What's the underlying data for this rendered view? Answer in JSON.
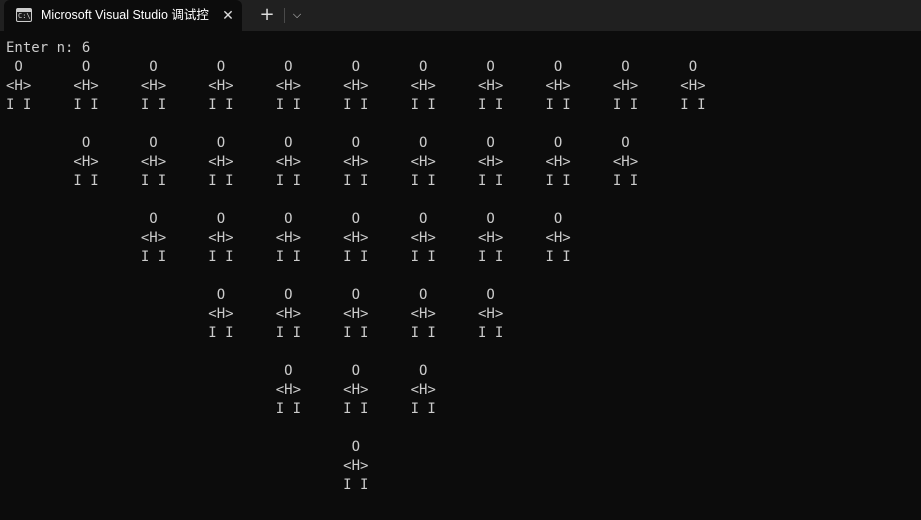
{
  "window": {
    "tab_title": "Microsoft Visual Studio 调试控制台",
    "tab_icon_text": "C:\\",
    "close_glyph": "✕",
    "new_tab_glyph": "+",
    "dropdown_glyph": "⌵"
  },
  "console": {
    "lines": [
      "Enter n: 6",
      " O       O       O       O       O       O       O       O       O       O       O",
      "<H>     <H>     <H>     <H>     <H>     <H>     <H>     <H>     <H>     <H>     <H>",
      "I I     I I     I I     I I     I I     I I     I I     I I     I I     I I     I I",
      "",
      "         O       O       O       O       O       O       O       O       O",
      "        <H>     <H>     <H>     <H>     <H>     <H>     <H>     <H>     <H>",
      "        I I     I I     I I     I I     I I     I I     I I     I I     I I",
      "",
      "                 O       O       O       O       O       O       O",
      "                <H>     <H>     <H>     <H>     <H>     <H>     <H>",
      "                I I     I I     I I     I I     I I     I I     I I",
      "",
      "                         O       O       O       O       O",
      "                        <H>     <H>     <H>     <H>     <H>",
      "                        I I     I I     I I     I I     I I",
      "",
      "                                 O       O       O",
      "                                <H>     <H>     <H>",
      "                                I I     I I     I I",
      "",
      "                                         O",
      "                                        <H>",
      "                                        I I"
    ]
  },
  "colors": {
    "console_background": "#0c0c0c",
    "titlebar_background": "#202020",
    "console_text": "#cccccc",
    "tab_text": "#ffffff"
  }
}
